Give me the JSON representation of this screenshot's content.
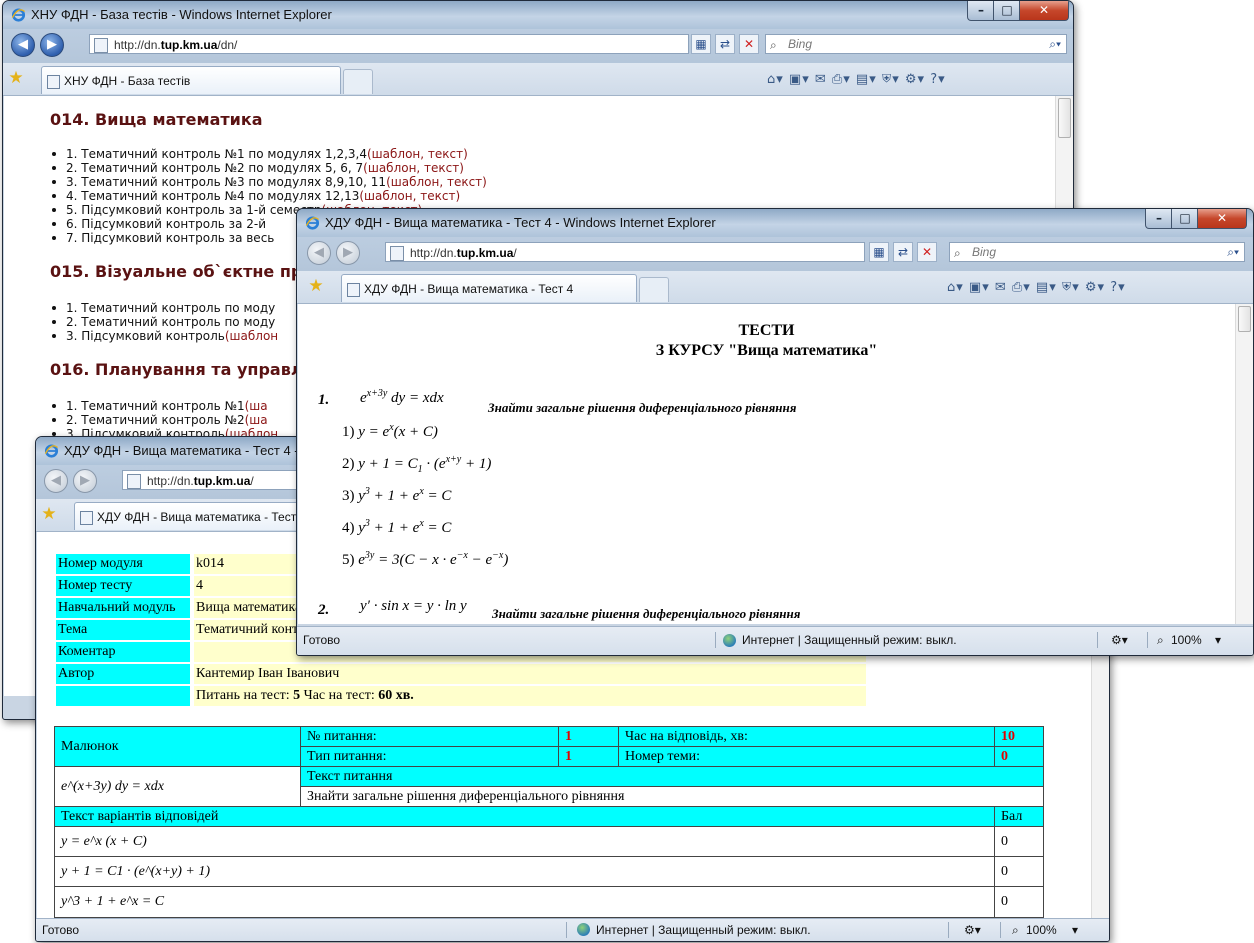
{
  "win1": {
    "title": "ХНУ ФДН - База тестів - Windows Internet Explorer",
    "url_prefix": "http://dn.",
    "url_domain": "tup.km.ua",
    "url_suffix": "/dn/",
    "search_placeholder": "Bing",
    "tab_title": "ХНУ ФДН - База тестів",
    "sections": [
      {
        "heading": "014. Вища математика",
        "items": [
          {
            "text": "1. Тематичний контроль №1 по модулях 1,2,3,4",
            "link": "(шаблон, текст)"
          },
          {
            "text": "2. Тематичний контроль №2 по модулях 5, 6, 7",
            "link": "(шаблон, текст)"
          },
          {
            "text": "3. Тематичний контроль №3 по модулях 8,9,10, 11",
            "link": "(шаблон, текст)"
          },
          {
            "text": "4. Тематичний контроль №4 по модулях 12,13",
            "link": "(шаблон, текст)"
          },
          {
            "text": "5. Підсумковий контроль за 1-й семестр",
            "link": "(шаблон, текст)"
          },
          {
            "text": "6. Підсумковий контроль за 2-й",
            "link": ""
          },
          {
            "text": "7. Підсумковий контроль за весь",
            "link": ""
          }
        ]
      },
      {
        "heading": "015. Візуальне об`єктне пр",
        "items": [
          {
            "text": "1. Тематичний контроль по моду",
            "link": ""
          },
          {
            "text": "2. Тематичний контроль по моду",
            "link": ""
          },
          {
            "text": "3. Підсумковий контроль",
            "link": "(шаблон"
          }
        ]
      },
      {
        "heading": "016. Планування та управл",
        "items": [
          {
            "text": "1. Тематичний контроль №1",
            "link": "(ша"
          },
          {
            "text": "2. Тематичний контроль №2",
            "link": "(ша"
          },
          {
            "text": "3. Підсумковий контроль",
            "link": "(шаблон"
          }
        ]
      }
    ]
  },
  "win2": {
    "title": "ХДУ ФДН - Вища математика - Тест 4 - Wi",
    "url_prefix": "http://dn.",
    "url_domain": "tup.km.ua",
    "url_suffix": "/",
    "tab_title": "ХДУ ФДН - Вища математика - Тест 4",
    "info": [
      {
        "key": "Номер модуля",
        "value": "k014"
      },
      {
        "key": "Номер тесту",
        "value": "4"
      },
      {
        "key": "Навчальний модуль",
        "value": "Вища математика"
      },
      {
        "key": "Тема",
        "value": "Тематичний контроль №4 по модулях 12,13"
      },
      {
        "key": "Коментар",
        "value": ""
      },
      {
        "key": "Автор",
        "value": "Кантемир Іван Іванович"
      }
    ],
    "summary": {
      "q_label": "Питань на тест:",
      "q_value": "5",
      "t_label": "Час на тест:",
      "t_value": "60 хв."
    },
    "question": {
      "picture_label": "Малюнок",
      "num_label": "№ питання:",
      "num_value": "1",
      "time_label": "Час на відповідь, хв:",
      "time_value": "10",
      "type_label": "Тип питання:",
      "type_value": "1",
      "topic_label": "Номер теми:",
      "topic_value": "0",
      "formula": "e^(x+3y) dy = xdx",
      "text_header": "Текст питання",
      "text": "Знайти загальне рішення диференціального рівняння",
      "answers_header": "Текст варіантів відповідей",
      "score_header": "Бал",
      "answers": [
        {
          "formula": "y = e^x (x + C)",
          "score": "0"
        },
        {
          "formula": "y + 1 = C1 · (e^(x+y) + 1)",
          "score": "0"
        },
        {
          "formula": "y^3 + 1 + e^x = C",
          "score": "0"
        }
      ]
    },
    "status": {
      "ready": "Готово",
      "zone": "Интернет | Защищенный режим: выкл.",
      "zoom": "100%"
    }
  },
  "win3": {
    "title": "ХДУ ФДН - Вища математика - Тест 4 - Windows Internet Explorer",
    "url_prefix": "http://dn.",
    "url_domain": "tup.km.ua",
    "url_suffix": "/",
    "search_placeholder": "Bing",
    "tab_title": "ХДУ ФДН - Вища математика - Тест 4",
    "heading1": "ТЕСТИ",
    "heading2": "З КУРСУ \"Вища математика\"",
    "q1": {
      "num": "1.",
      "task": "Знайти загальне рішення диференціального рівняння",
      "options": [
        "1)",
        "2)",
        "3)",
        "4)",
        "5)"
      ]
    },
    "q2": {
      "num": "2.",
      "task": "Знайти загальне рішення диференціального рівняння"
    },
    "status": {
      "ready": "Готово",
      "zone": "Интернет | Защищенный режим: выкл.",
      "zoom": "100%"
    }
  },
  "icons": [
    "ie-logo-icon",
    "back-arrow-icon",
    "forward-arrow-icon",
    "page-icon",
    "compat-view-icon",
    "refresh-icon",
    "stop-icon",
    "search-icon",
    "favorites-star-icon",
    "home-icon",
    "feeds-icon",
    "mail-icon",
    "print-icon",
    "page-menu-icon",
    "safety-icon",
    "tools-gear-icon",
    "help-icon",
    "globe-icon",
    "zoom-icon"
  ]
}
